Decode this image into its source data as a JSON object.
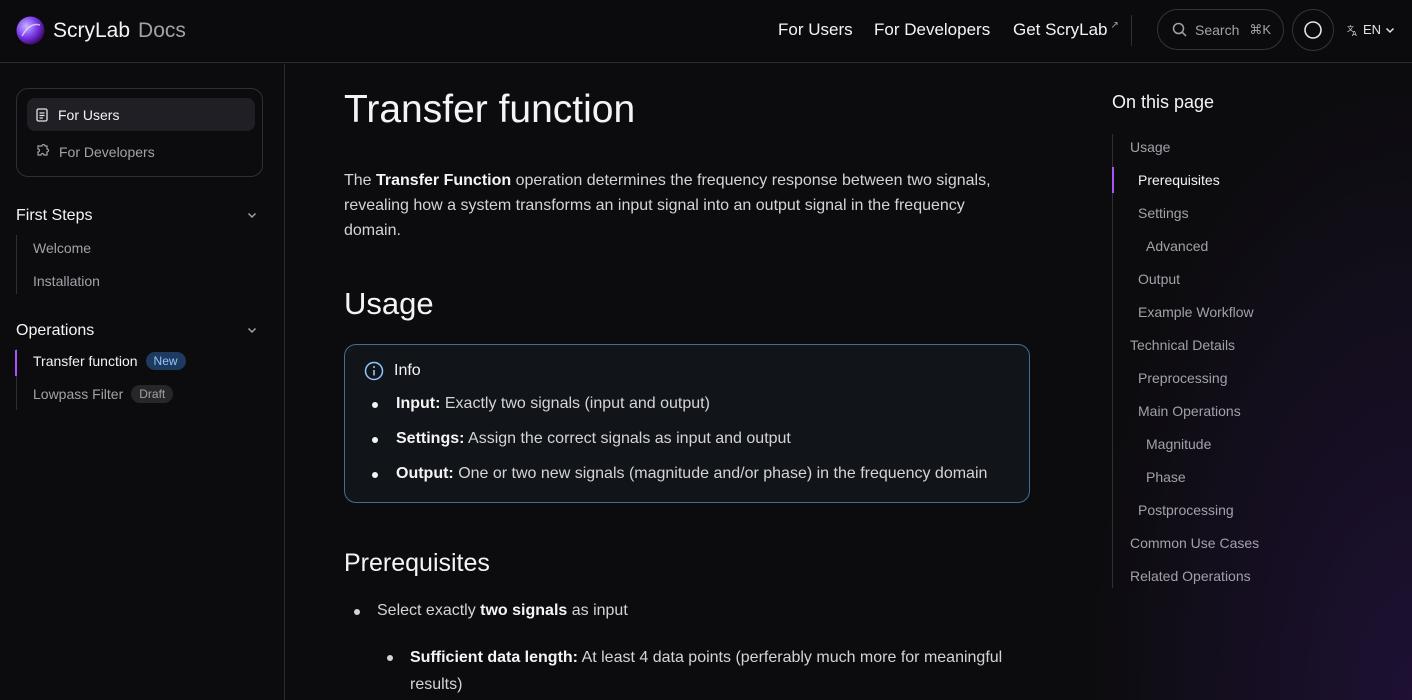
{
  "header": {
    "brand": "ScryLab",
    "brand_suffix": "Docs",
    "nav": [
      {
        "label": "For Users"
      },
      {
        "label": "For Developers"
      },
      {
        "label": "Get ScryLab",
        "external_mark": "↗"
      }
    ],
    "search_label": "Search",
    "search_shortcut": "⌘K",
    "language": "EN",
    "icons": [
      "logo-icon",
      "search-icon",
      "theme-toggle-icon",
      "language-icon",
      "chevron-down-icon"
    ]
  },
  "sidebar": {
    "switcher": [
      {
        "label": "For Users",
        "icon": "document-icon",
        "active": true
      },
      {
        "label": "For Developers",
        "icon": "puzzle-icon",
        "active": false
      }
    ],
    "sections": [
      {
        "title": "First Steps",
        "items": [
          {
            "label": "Welcome"
          },
          {
            "label": "Installation"
          }
        ]
      },
      {
        "title": "Operations",
        "items": [
          {
            "label": "Transfer function",
            "badge": "New",
            "active": true
          },
          {
            "label": "Lowpass Filter",
            "badge": "Draft"
          }
        ]
      }
    ]
  },
  "main": {
    "title": "Transfer function",
    "intro_pre": "The ",
    "intro_bold": "Transfer Function",
    "intro_post": " operation determines the frequency response between two signals, revealing how a system transforms an input signal into an output signal in the frequency domain.",
    "usage_heading": "Usage",
    "callout": {
      "title": "Info",
      "items": [
        {
          "label": "Input:",
          "text": " Exactly two signals (input and output)"
        },
        {
          "label": "Settings:",
          "text": " Assign the correct signals as input and output"
        },
        {
          "label": "Output:",
          "text": " One or two new signals (magnitude and/or phase) in the frequency domain"
        }
      ]
    },
    "prereq_heading": "Prerequisites",
    "prereq_item_pre": "Select exactly ",
    "prereq_item_bold": "two signals",
    "prereq_item_post": " as input",
    "prereq_sub_bold": "Sufficient data length:",
    "prereq_sub_text": " At least 4 data points (perferably much more for meaningful results)"
  },
  "toc": {
    "title": "On this page",
    "items": [
      {
        "label": "Usage",
        "level": 1
      },
      {
        "label": "Prerequisites",
        "level": 2,
        "active": true
      },
      {
        "label": "Settings",
        "level": 2
      },
      {
        "label": "Advanced",
        "level": 3
      },
      {
        "label": "Output",
        "level": 2
      },
      {
        "label": "Example Workflow",
        "level": 2
      },
      {
        "label": "Technical Details",
        "level": 1
      },
      {
        "label": "Preprocessing",
        "level": 2
      },
      {
        "label": "Main Operations",
        "level": 2
      },
      {
        "label": "Magnitude",
        "level": 3
      },
      {
        "label": "Phase",
        "level": 3
      },
      {
        "label": "Postprocessing",
        "level": 2
      },
      {
        "label": "Common Use Cases",
        "level": 1
      },
      {
        "label": "Related Operations",
        "level": 1
      }
    ]
  },
  "colors": {
    "accent": "#a855f7",
    "callout_border": "#4a6a8a",
    "badge_new": "#93c5fd"
  }
}
